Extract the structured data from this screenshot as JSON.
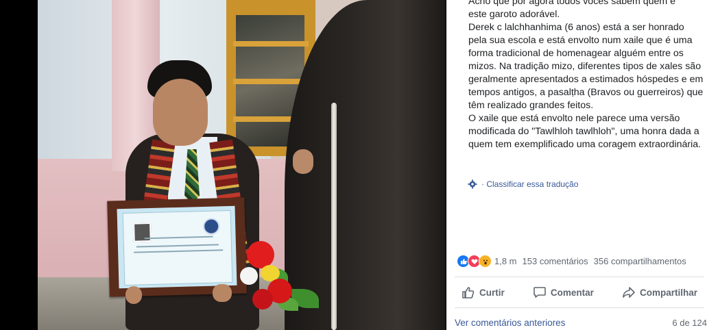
{
  "post": {
    "text": "Acho que por agora todos vocês sabem quem é\neste garoto adorável.\nDerek c lalchhanhima (6 anos) está a ser honrado pela sua escola e está envolto num xaile que é uma forma tradicional de homenagear alguém entre os mizos. Na tradição mizo, diferentes tipos de xales são geralmente apresentados a estimados hóspedes e em tempos antigos, a pasalṭha (Bravos ou guerreiros) que têm realizado grandes feitos.\nO xaile que está envolto nele parece uma versão modificada do \"Tawlhloh tawlhloh\", uma honra dada a quem tem exemplificado uma coragem extraordinária.",
    "translate_icon": "gear-icon",
    "translate_label": "· Classificar essa tradução"
  },
  "reactions": {
    "icons": [
      "like-icon",
      "love-icon",
      "wow-icon"
    ],
    "colors": {
      "like": "#1877f2",
      "love": "#f33e58",
      "wow": "#f7b125"
    },
    "count": "1,8 m",
    "comments": "153 comentários",
    "shares": "356 compartilhamentos"
  },
  "actions": [
    {
      "label": "Curtir",
      "icon": "thumbs-up-icon"
    },
    {
      "label": "Comentar",
      "icon": "comment-icon"
    },
    {
      "label": "Compartilhar",
      "icon": "share-arrow-icon"
    }
  ],
  "footer": {
    "more_comments": "Ver comentários anteriores",
    "page_count": "6 de 124"
  },
  "colors": {
    "link": "#385898",
    "muted": "#606770",
    "text": "#1c1e21"
  }
}
